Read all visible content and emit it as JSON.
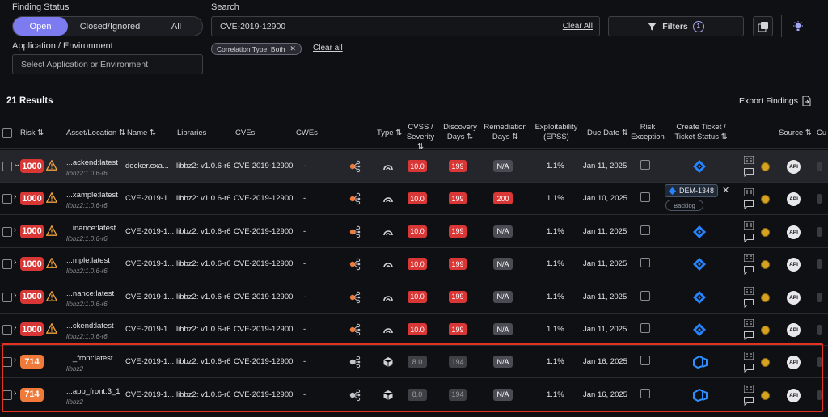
{
  "filters": {
    "finding_status_label": "Finding Status",
    "status_options": [
      "Open",
      "Closed/Ignored",
      "All"
    ],
    "app_env_label": "Application / Environment",
    "app_env_placeholder": "Select Application or Environment",
    "search_label": "Search",
    "search_value": "CVE-2019-12900",
    "clear_all": "Clear All",
    "filters_button": "Filters",
    "filters_count": "1",
    "chip": "Correlation Type: Both",
    "clear_all_small": "Clear all"
  },
  "results": {
    "count_label": "21 Results",
    "export_label": "Export Findings"
  },
  "columns": {
    "risk": "Risk",
    "asset": "Asset/Location",
    "name": "Name",
    "libraries": "Libraries",
    "cves": "CVEs",
    "cwes": "CWEs",
    "type": "Type",
    "cvss_1": "CVSS /",
    "cvss_2": "Severity",
    "disc_1": "Discovery",
    "disc_2": "Days",
    "rem_1": "Remediation",
    "rem_2": "Days",
    "expl_1": "Exploitability",
    "expl_2": "(EPSS)",
    "due": "Due Date",
    "riskex_1": "Risk",
    "riskex_2": "Exception",
    "ticket_1": "Create Ticket /",
    "ticket_2": "Ticket Status",
    "source": "Source",
    "cut": "Cu"
  },
  "rows": [
    {
      "risk": "1000",
      "asset": "...ackend:latest",
      "asset_sub": "libbz2:1.0.6-r6",
      "name": "docker.exa...",
      "lib": "libbz2: v1.0.6-r6",
      "cve": "CVE-2019-12900",
      "cwe": "-",
      "cvss": "10.0",
      "disc": "199",
      "rem": "N/A",
      "epss": "1.1%",
      "due": "Jan 11, 2025",
      "api": "API"
    },
    {
      "risk": "1000",
      "asset": "...xample:latest",
      "asset_sub": "libbz2:1.0.6-r6",
      "name": "CVE-2019-1...",
      "lib": "libbz2: v1.0.6-r6",
      "cve": "CVE-2019-12900",
      "cwe": "-",
      "cvss": "10.0",
      "disc": "199",
      "rem": "200",
      "epss": "1.1%",
      "due": "Jan 10, 2025",
      "api": "API"
    },
    {
      "risk": "1000",
      "asset": "...inance:latest",
      "asset_sub": "libbz2:1.0.6-r6",
      "name": "CVE-2019-1...",
      "lib": "libbz2: v1.0.6-r6",
      "cve": "CVE-2019-12900",
      "cwe": "-",
      "cvss": "10.0",
      "disc": "199",
      "rem": "N/A",
      "epss": "1.1%",
      "due": "Jan 11, 2025",
      "api": "API"
    },
    {
      "risk": "1000",
      "asset": "...mple:latest",
      "asset_sub": "libbz2:1.0.6-r6",
      "name": "CVE-2019-1...",
      "lib": "libbz2: v1.0.6-r6",
      "cve": "CVE-2019-12900",
      "cwe": "-",
      "cvss": "10.0",
      "disc": "199",
      "rem": "N/A",
      "epss": "1.1%",
      "due": "Jan 11, 2025",
      "api": "API"
    },
    {
      "risk": "1000",
      "asset": "...nance:latest",
      "asset_sub": "libbz2:1.0.6-r6",
      "name": "CVE-2019-1...",
      "lib": "libbz2: v1.0.6-r6",
      "cve": "CVE-2019-12900",
      "cwe": "-",
      "cvss": "10.0",
      "disc": "199",
      "rem": "N/A",
      "epss": "1.1%",
      "due": "Jan 11, 2025",
      "api": "API"
    },
    {
      "risk": "1000",
      "asset": "...ckend:latest",
      "asset_sub": "libbz2:1.0.6-r6",
      "name": "CVE-2019-1...",
      "lib": "libbz2: v1.0.6-r6",
      "cve": "CVE-2019-12900",
      "cwe": "-",
      "cvss": "10.0",
      "disc": "199",
      "rem": "N/A",
      "epss": "1.1%",
      "due": "Jan 11, 2025",
      "api": "API"
    },
    {
      "risk": "714",
      "asset": "..._front:latest",
      "asset_sub": "libbz2",
      "name": "CVE-2019-1...",
      "lib": "libbz2: v1.0.6-r6",
      "cve": "CVE-2019-12900",
      "cwe": "-",
      "cvss": "8.0",
      "disc": "194",
      "rem": "N/A",
      "epss": "1.1%",
      "due": "Jan 16, 2025",
      "api": "API"
    },
    {
      "risk": "714",
      "asset": "...app_front:3_1",
      "asset_sub": "libbz2",
      "name": "CVE-2019-1...",
      "lib": "libbz2: v1.0.6-r6",
      "cve": "CVE-2019-12900",
      "cwe": "-",
      "cvss": "8.0",
      "disc": "194",
      "rem": "N/A",
      "epss": "1.1%",
      "due": "Jan 16, 2025",
      "api": "API"
    }
  ],
  "ticket_popup": {
    "id": "DEM-1348",
    "status": "Backlog"
  },
  "colors": {
    "accent": "#7c7cf0",
    "critical": "#d93636",
    "high": "#f07a3a",
    "jira": "#2684ff",
    "highlight": "#e53222"
  }
}
